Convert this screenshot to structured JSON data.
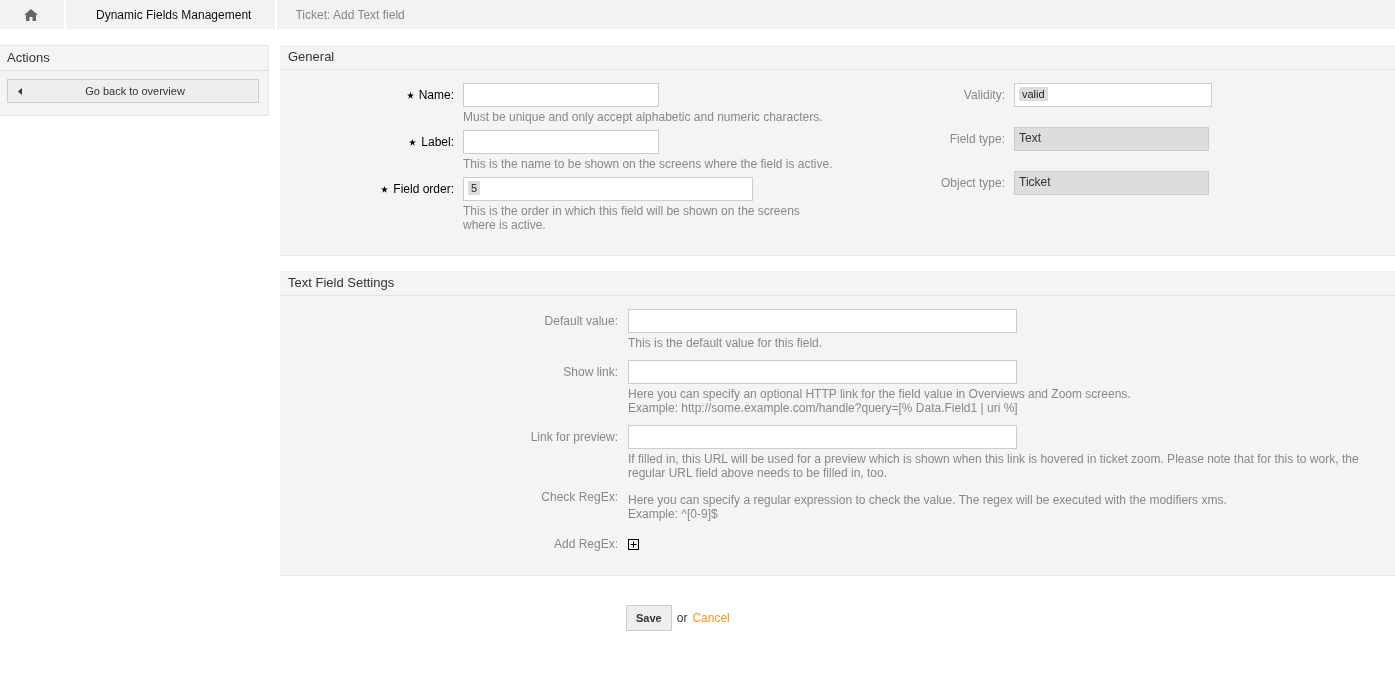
{
  "breadcrumb": [
    {
      "label": "Dynamic Fields Management",
      "current": false
    },
    {
      "label": "Ticket: Add Text field",
      "current": true
    }
  ],
  "sidebar": {
    "title": "Actions",
    "button": "Go back to overview"
  },
  "general": {
    "title": "General",
    "left": [
      {
        "label": "Name:",
        "required": true,
        "kind": "input",
        "hint": [
          "Must be unique and only accept alphabetic and numeric characters."
        ]
      },
      {
        "label": "Label:",
        "required": true,
        "kind": "input",
        "hint": [
          "This is the name to be shown on the screens where the field is active."
        ]
      },
      {
        "label": "Field order:",
        "required": true,
        "kind": "chip",
        "value": "5",
        "hint": [
          "This is the order in which this field will be shown on the screens",
          "where is active."
        ]
      }
    ],
    "right": [
      {
        "label": "Validity:",
        "required": false,
        "kind": "chip",
        "value": "valid"
      },
      {
        "label": "Field type:",
        "required": false,
        "kind": "readonly",
        "value": "Text"
      },
      {
        "label": "Object type:",
        "required": false,
        "kind": "readonly",
        "value": "Ticket"
      }
    ]
  },
  "settings": {
    "title": "Text Field Settings",
    "rows": [
      {
        "label": "Default value:",
        "kind": "input",
        "hint": [
          "This is the default value for this field."
        ]
      },
      {
        "label": "Show link:",
        "kind": "input",
        "hint": [
          "Here you can specify an optional HTTP link for the field value in Overviews and Zoom screens.",
          "Example: http://some.example.com/handle?query=[% Data.Field1 | uri %]"
        ]
      },
      {
        "label": "Link for preview:",
        "kind": "input",
        "hint": [
          "If filled in, this URL will be used for a preview which is shown when this link is hovered in ticket zoom. Please note that for this to work, the regular URL field above needs to be filled in, too."
        ]
      },
      {
        "label": "Check RegEx:",
        "kind": "text",
        "hint": [
          "Here you can specify a regular expression to check the value. The regex will be executed with the modifiers xms.",
          "Example: ^[0-9]$"
        ]
      },
      {
        "label": "Add RegEx:",
        "kind": "add"
      }
    ]
  },
  "footer": {
    "save": "Save",
    "or": "or",
    "cancel": "Cancel"
  }
}
